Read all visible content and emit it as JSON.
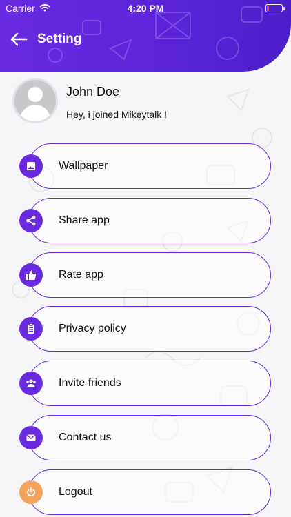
{
  "status_bar": {
    "carrier": "Carrier",
    "time": "4:20 PM",
    "battery_level": 0.12
  },
  "nav": {
    "back_icon": "arrow-left-icon",
    "title": "Setting"
  },
  "profile": {
    "name": "John Doe",
    "status": "Hey, i joined Mikeytalk !"
  },
  "menu": [
    {
      "label": "Wallpaper",
      "icon": "image-icon"
    },
    {
      "label": "Share app",
      "icon": "share-icon"
    },
    {
      "label": "Rate app",
      "icon": "thumbs-up-icon"
    },
    {
      "label": "Privacy policy",
      "icon": "clipboard-icon"
    },
    {
      "label": "Invite friends",
      "icon": "people-icon"
    },
    {
      "label": "Contact us",
      "icon": "envelope-icon"
    },
    {
      "label": "Logout",
      "icon": "power-icon"
    }
  ],
  "colors": {
    "accent": "#6a2ae0",
    "logout_icon": "#f3a35c",
    "background": "#f6f6f8"
  }
}
